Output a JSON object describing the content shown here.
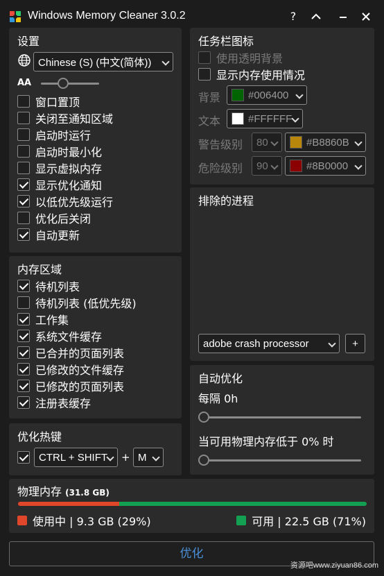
{
  "window": {
    "title": "Windows Memory Cleaner 3.0.2",
    "help": "?",
    "colors": {
      "bg": "#1c1c1c",
      "panel": "#2b2b2b",
      "accent": "#4a90d9",
      "used": "#e0462a",
      "free": "#14a052"
    }
  },
  "settings": {
    "title": "设置",
    "language": "Chinese (S) (中文(简体))",
    "font_size_icon": "AA",
    "font_size_level": 0.35,
    "items": [
      {
        "label": "窗口置顶",
        "checked": false
      },
      {
        "label": "关闭至通知区域",
        "checked": false
      },
      {
        "label": "启动时运行",
        "checked": false
      },
      {
        "label": "启动时最小化",
        "checked": false
      },
      {
        "label": "显示虚拟内存",
        "checked": false
      },
      {
        "label": "显示优化通知",
        "checked": true
      },
      {
        "label": "以低优先级运行",
        "checked": true
      },
      {
        "label": "优化后关闭",
        "checked": false
      },
      {
        "label": "自动更新",
        "checked": true
      }
    ]
  },
  "memory_areas": {
    "title": "内存区域",
    "items": [
      {
        "label": "待机列表",
        "checked": true
      },
      {
        "label": "待机列表 (低优先级)",
        "checked": false
      },
      {
        "label": "工作集",
        "checked": true
      },
      {
        "label": "系统文件缓存",
        "checked": true
      },
      {
        "label": "已合并的页面列表",
        "checked": true
      },
      {
        "label": "已修改的文件缓存",
        "checked": true
      },
      {
        "label": "已修改的页面列表",
        "checked": true
      },
      {
        "label": "注册表缓存",
        "checked": true
      }
    ]
  },
  "hotkey": {
    "title": "优化热键",
    "enabled": true,
    "modifier": "CTRL + SHIFT",
    "plus": "+",
    "key": "M"
  },
  "tray_icon": {
    "title": "任务栏图标",
    "transparent_bg": "使用透明背景",
    "show_usage": "显示内存使用情况",
    "background_label": "背景",
    "background_color": "#006400",
    "text_label": "文本",
    "text_color": "#FFFFFF",
    "warning_label": "警告级别",
    "warning_level": "80",
    "warning_color": "#B8860B",
    "danger_label": "危险级别",
    "danger_level": "90",
    "danger_color": "#8B0000"
  },
  "excluded": {
    "title": "排除的进程",
    "process": "adobe crash processor",
    "add": "+"
  },
  "auto_optimize": {
    "title": "自动优化",
    "interval_label": "每隔 0h",
    "interval_level": 0,
    "threshold_label": "当可用物理内存低于 0% 时",
    "threshold_level": 0
  },
  "physical_memory": {
    "title": "物理内存",
    "total": "(31.8 GB)",
    "used_fraction": 0.29,
    "used_label": "使用中 | 9.3 GB (29%)",
    "free_label": "可用 | 22.5 GB (71%)"
  },
  "optimize_button": "优化",
  "watermark": "资源吧www.ziyuan86.com"
}
